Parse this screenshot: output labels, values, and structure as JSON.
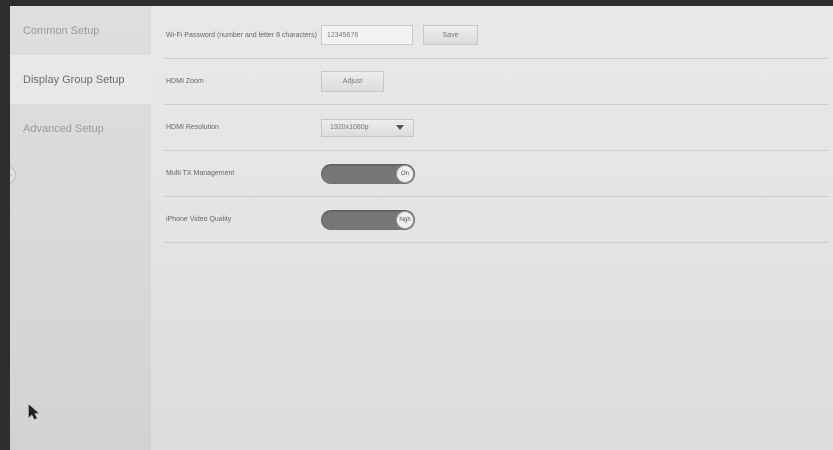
{
  "sidebar": {
    "items": [
      {
        "label": "Common Setup"
      },
      {
        "label": "Display Group Setup"
      },
      {
        "label": "Advanced Setup"
      }
    ]
  },
  "settings": {
    "wifi_password": {
      "label": "Wi-Fi Password (number and letter 8 characters)",
      "value": "12345678",
      "button_label": "Save"
    },
    "hdmi_zoom": {
      "label": "HDMI Zoom",
      "button_label": "Adjust"
    },
    "hdmi_resolution": {
      "label": "HDMI Resolution",
      "selected": "1920x1080p"
    },
    "multi_tx": {
      "label": "Multi TX Management",
      "state": "On"
    },
    "iphone_video_quality": {
      "label": "iPhone Video Quality",
      "state": "high"
    }
  },
  "colors": {
    "toggle_track": "#777777",
    "background": "#e6e6e6"
  }
}
